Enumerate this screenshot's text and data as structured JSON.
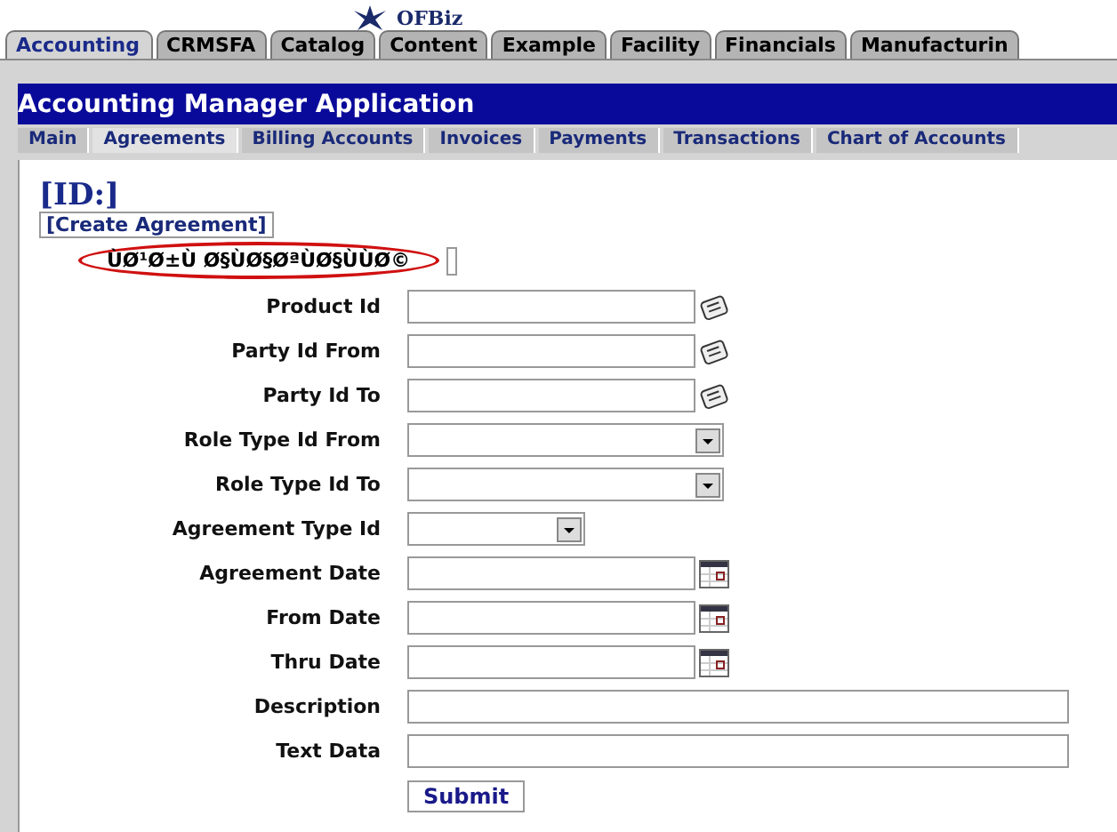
{
  "logo": {
    "text": "OFBiz"
  },
  "tabs": [
    {
      "label": "Accounting",
      "selected": true
    },
    {
      "label": "CRMSFA",
      "selected": false
    },
    {
      "label": "Catalog",
      "selected": false
    },
    {
      "label": "Content",
      "selected": false
    },
    {
      "label": "Example",
      "selected": false
    },
    {
      "label": "Facility",
      "selected": false
    },
    {
      "label": "Financials",
      "selected": false
    },
    {
      "label": "Manufacturin",
      "selected": false
    }
  ],
  "app_title": "Accounting Manager Application",
  "subnav": [
    {
      "label": "Main",
      "selected": false
    },
    {
      "label": "Agreements",
      "selected": true
    },
    {
      "label": "Billing Accounts",
      "selected": false
    },
    {
      "label": "Invoices",
      "selected": false
    },
    {
      "label": "Payments",
      "selected": false
    },
    {
      "label": "Transactions",
      "selected": false
    },
    {
      "label": "Chart of Accounts",
      "selected": false
    }
  ],
  "heading": "[ID:]",
  "create_link": "[Create Agreement]",
  "garbled_label": {
    "text": "ÙØ¹Ø±Ù Ø§ÙØ§ØªÙØ§ÙÙØ©",
    "circled": true
  },
  "fields": [
    {
      "label": "Product Id",
      "kind": "lookup"
    },
    {
      "label": "Party Id From",
      "kind": "lookup"
    },
    {
      "label": "Party Id To",
      "kind": "lookup"
    },
    {
      "label": "Role Type Id From",
      "kind": "select"
    },
    {
      "label": "Role Type Id To",
      "kind": "select"
    },
    {
      "label": "Agreement Type Id",
      "kind": "shortselect"
    },
    {
      "label": "Agreement Date",
      "kind": "date"
    },
    {
      "label": "From Date",
      "kind": "date"
    },
    {
      "label": "Thru Date",
      "kind": "date"
    },
    {
      "label": "Description",
      "kind": "longtext"
    },
    {
      "label": "Text Data",
      "kind": "longtext"
    }
  ],
  "submit": "Submit"
}
